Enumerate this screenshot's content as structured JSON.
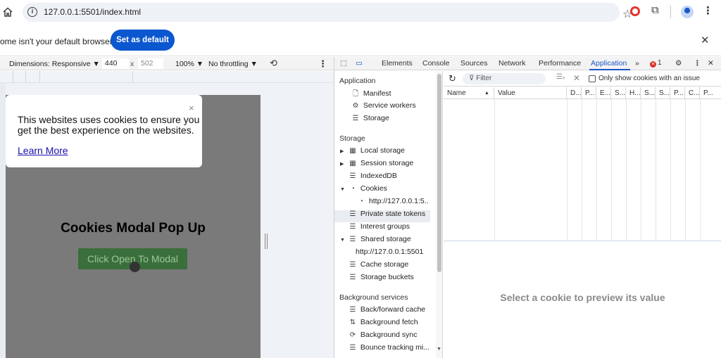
{
  "browser": {
    "url": "127.0.0.1:5501/index.html",
    "infobar_text": "ome isn't your default browser",
    "set_default_label": "Set as default",
    "close_glyph": "✕"
  },
  "device_toolbar": {
    "dimensions_label": "Dimensions: Responsive ▼",
    "width": "440",
    "x_glyph": "x",
    "height": "502",
    "zoom": "100% ▼",
    "throttle": "No throttling ▼"
  },
  "page": {
    "modal_text": "This websites uses cookies to ensure you get the best experience on the websites.",
    "modal_link": "Learn More",
    "modal_close": "×",
    "heading": "Cookies Modal Pop Up",
    "button_label": "Click Open To Modal"
  },
  "devtools": {
    "tabs": [
      "Elements",
      "Console",
      "Sources",
      "Network",
      "Performance",
      "Application"
    ],
    "more_tabs": "»",
    "error_count": "1",
    "sidebar": {
      "application_header": "Application",
      "application_items": [
        "Manifest",
        "Service workers",
        "Storage"
      ],
      "storage_header": "Storage",
      "storage_items": [
        "Local storage",
        "Session storage",
        "IndexedDB",
        "Cookies",
        "http://127.0.0.1:5...",
        "Private state tokens",
        "Interest groups",
        "Shared storage",
        "http://127.0.0.1:5501",
        "Cache storage",
        "Storage buckets"
      ],
      "background_header": "Background services",
      "background_items": [
        "Back/forward cache",
        "Background fetch",
        "Background sync",
        "Bounce tracking mi..."
      ]
    },
    "cookies": {
      "filter_placeholder": "Filter",
      "issue_checkbox_label": "Only show cookies with an issue",
      "columns": [
        "Name",
        "Value",
        "D...",
        "P...",
        "E...",
        "S...",
        "H...",
        "S...",
        "S...",
        "P...",
        "C...",
        "P..."
      ],
      "sort_glyph": "▲",
      "preview_text": "Select a cookie to preview its value"
    }
  }
}
